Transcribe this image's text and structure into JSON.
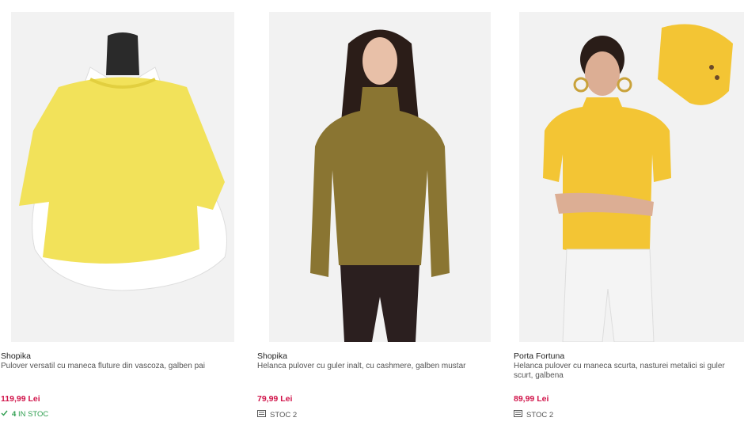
{
  "products": [
    {
      "brand": "Shopika",
      "title": "Pulover versatil cu maneca fluture din vascoza, galben pai",
      "price": "119,99 Lei",
      "stock_count": "4",
      "stock_label": "IN STOC",
      "stock_icon": "check-icon",
      "color": "#f2e25a"
    },
    {
      "brand": "Shopika",
      "title": "Helanca pulover cu guler inalt, cu cashmere, galben mustar",
      "price": "79,99 Lei",
      "stock_label": "STOC 2",
      "stock_icon": "stock-list-icon",
      "color": "#8a7532"
    },
    {
      "brand": "Porta Fortuna",
      "title": "Helanca pulover cu maneca scurta, nasturei metalici si guler scurt, galbena",
      "price": "89,99 Lei",
      "stock_label": "STOC 2",
      "stock_icon": "stock-list-icon",
      "color": "#f3c534"
    }
  ],
  "colors": {
    "price": "#d1144a",
    "in_stock": "#2e9e4f"
  }
}
